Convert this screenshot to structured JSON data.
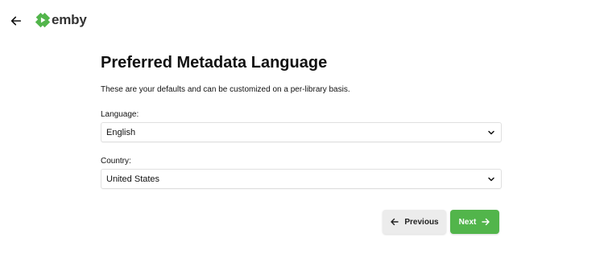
{
  "header": {
    "back_icon": "arrow-left-icon",
    "logo_icon": "emby-play-diamond-icon",
    "logo_text": "emby"
  },
  "page": {
    "title": "Preferred Metadata Language",
    "subtitle": "These are your defaults and can be customized on a per-library basis."
  },
  "fields": {
    "language": {
      "label": "Language:",
      "value": "English",
      "icon": "chevron-down-icon"
    },
    "country": {
      "label": "Country:",
      "value": "United States",
      "icon": "chevron-down-icon"
    }
  },
  "buttons": {
    "previous_label": "Previous",
    "previous_icon": "arrow-left-icon",
    "next_label": "Next",
    "next_icon": "arrow-right-icon"
  },
  "colors": {
    "accent": "#52b54b",
    "secondary_button": "#ececec",
    "text": "#111111"
  }
}
